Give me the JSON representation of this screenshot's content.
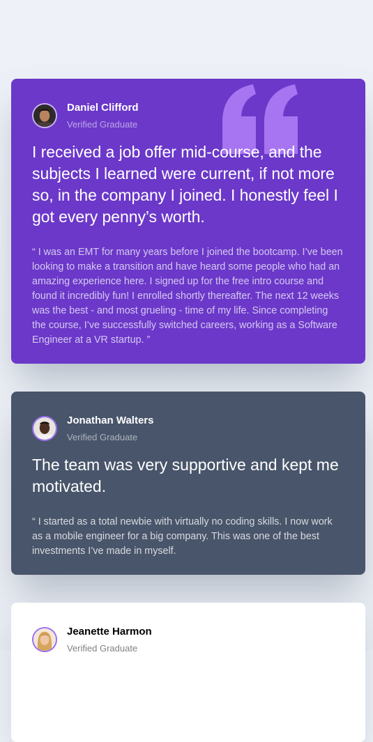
{
  "testimonials": [
    {
      "name": "Daniel Clifford",
      "role": "Verified Graduate",
      "avatar_icon": "avatar-daniel",
      "background": "#6b38c9",
      "headline": "I received a job offer mid-course, and the subjects I learned were current, if not more so, in the company I joined. I honestly feel I got every penny’s worth.",
      "quote": "“ I was an EMT for many years before I joined the bootcamp. I’ve been looking to make a transition and have heard some people who had an amazing experience here. I signed up for the free intro course and found it incredibly fun! I enrolled shortly thereafter. The next 12 weeks was the best - and most grueling - time of my life. Since completing the course, I’ve successfully switched careers, working as a Software Engineer at a VR startup. ”"
    },
    {
      "name": "Jonathan Walters",
      "role": "Verified Graduate",
      "avatar_icon": "avatar-jonathan",
      "background": "#48556a",
      "headline": "The team was very supportive and kept me motivated.",
      "quote": "“ I started as a total newbie with virtually no coding skills. I now work as a mobile engineer for a big company. This was one of the best investments I’ve made in myself."
    },
    {
      "name": "Jeanette Harmon",
      "role": "Verified Graduate",
      "avatar_icon": "avatar-jeanette",
      "background": "#ffffff"
    }
  ],
  "colors": {
    "page_background": "#edf1f7",
    "accent_purple": "#6b38c9",
    "quote_mark": "#a775f1",
    "slate": "#48556a"
  },
  "icons": {
    "quote_mark": "quote-mark-icon"
  }
}
